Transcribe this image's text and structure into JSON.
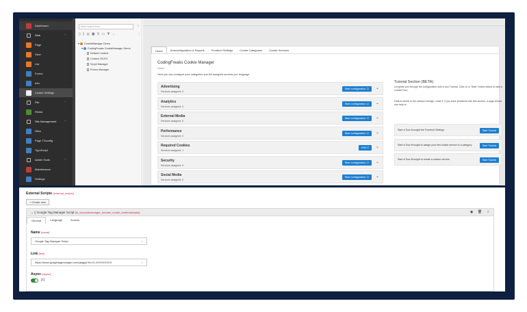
{
  "sidebar": {
    "items": [
      {
        "label": "Dashboard",
        "color": "#c13b3b",
        "group": false
      },
      {
        "label": "Web",
        "color": "",
        "group": true
      },
      {
        "label": "Page",
        "color": "#e6772e",
        "group": false
      },
      {
        "label": "View",
        "color": "#e6772e",
        "group": false
      },
      {
        "label": "List",
        "color": "#e6772e",
        "group": false
      },
      {
        "label": "Forms",
        "color": "#3f7fc4",
        "group": false
      },
      {
        "label": "Info",
        "color": "#3f7fc4",
        "group": false
      },
      {
        "label": "Cookie Settings",
        "color": "#f0f0f0",
        "group": false
      },
      {
        "label": "File",
        "color": "",
        "group": true
      },
      {
        "label": "Filelist",
        "color": "#4a8d3a",
        "group": false
      },
      {
        "label": "Site Management",
        "color": "",
        "group": true
      },
      {
        "label": "Sites",
        "color": "#3f7fc4",
        "group": false
      },
      {
        "label": "Page TSconfig",
        "color": "#3f7fc4",
        "group": false
      },
      {
        "label": "TypoScript",
        "color": "#3f7fc4",
        "group": false
      },
      {
        "label": "Admin Tools",
        "color": "",
        "group": true
      },
      {
        "label": "Maintenance",
        "color": "#c13b3b",
        "group": false
      },
      {
        "label": "Settings",
        "color": "#3f7fc4",
        "group": false
      }
    ]
  },
  "tree": {
    "search_placeholder": "Enter search term",
    "nodes": [
      "CookieManager Demo",
      "CodingFreaks CookieManager Demo",
      "Default Content",
      "Custom 25.871",
      "Script Manager",
      "Promo Manager"
    ]
  },
  "main": {
    "tabs": [
      "Home",
      "Autoconfiguration & Reports",
      "Frontend Settings",
      "Cookie Categories",
      "Cookie Services"
    ],
    "title": "CodingFreaks Cookie Manager",
    "subtitle": "Home",
    "description": "Here you can configure your categories and the assigned services per language",
    "categories": [
      {
        "title": "Advertising",
        "sub": "Services assigned: 0",
        "button": "Start configuration ☐"
      },
      {
        "title": "Analytics",
        "sub": "Services assigned: 0",
        "button": "Start configuration ☐"
      },
      {
        "title": "External Media",
        "sub": "Services assigned: 0",
        "button": "Start configuration ☐"
      },
      {
        "title": "Performance",
        "sub": "Services assigned: 0",
        "button": "Start configuration ☐"
      },
      {
        "title": "Required Cookies",
        "sub": "Services assigned: 1",
        "button": "Edit ☐"
      },
      {
        "title": "Security",
        "sub": "Services assigned: 0",
        "button": "Start configuration ☐"
      },
      {
        "title": "Social Media",
        "sub": "Services assigned: 0",
        "button": "Start configuration ☐"
      }
    ],
    "tutorial": {
      "title": "Tutorial Section (BETA)",
      "intro": "Let guide you through the configuration with a tour Tutorial. Click on a \"Start\" button below to start a Guided Tour",
      "note": "Data is stored in the session storage, close it, if you have problems with this section, a page reload can help to.",
      "cards": [
        {
          "text": "Start a Tour throught the Frontend Settings",
          "button": "Start Tutorial"
        },
        {
          "text": "Start a Tour throught to assign your first cookie service to a category",
          "button": "Start Tutorial"
        },
        {
          "text": "Start a Tour throught to create a custom service.",
          "button": "Start Tutorial"
        }
      ]
    }
  },
  "form": {
    "section_label": "External Scripts",
    "section_code": "[external_scripts]",
    "create_button": "+ Create new",
    "record_title": "Google Tag Manager Script",
    "record_code": "[tx_cfcookiemanager_domain_model_externalscripts]",
    "tabs": [
      "General",
      "Language",
      "Access"
    ],
    "name_label": "Name",
    "name_code": "[name]",
    "name_value": "Google Tag Manager Script",
    "link_label": "Link",
    "link_code": "[link]",
    "link_value": "https://www.googletagmanager.com/gtag/js?id=G-XXXXXXXXX",
    "async_label": "Async",
    "async_code": "[async]",
    "async_value": "[1]"
  }
}
